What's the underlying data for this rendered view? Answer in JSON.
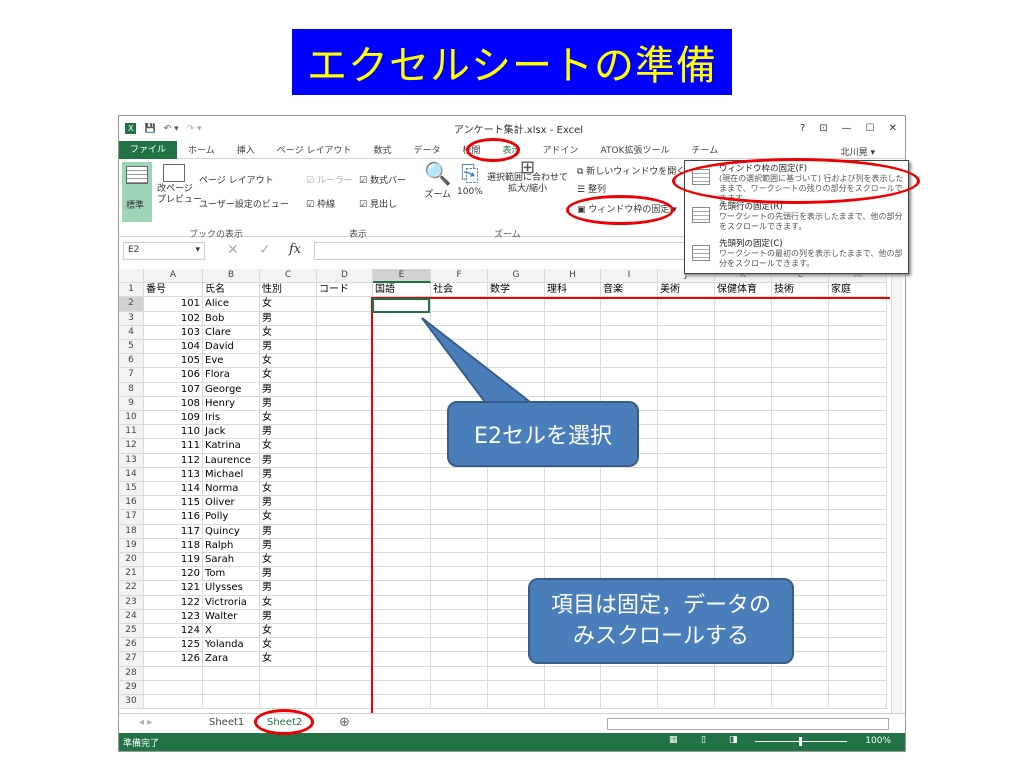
{
  "slide": {
    "title": "エクセルシートの準備",
    "callout1": "E2セルを選択",
    "callout2": "項目は固定，データのみスクロールする"
  },
  "window": {
    "title": "アンケート集計.xlsx - Excel",
    "user": "北川晃 ▾",
    "controls": [
      "?",
      "⊡",
      "—",
      "☐",
      "✕"
    ]
  },
  "tabs": [
    "ファイル",
    "ホーム",
    "挿入",
    "ページ レイアウト",
    "数式",
    "データ",
    "校閲",
    "表示",
    "アドイン",
    "ATOK拡張ツール",
    "チーム"
  ],
  "active_tab": "表示",
  "ribbon": {
    "normal": "標準",
    "page_break": "改ページ\nプレビュー",
    "page_layout": "ページ レイアウト",
    "custom_view": "ユーザー設定のビュー",
    "group_book": "ブックの表示",
    "ruler": "ルーラー",
    "formula_bar": "数式バー",
    "gridlines": "枠線",
    "headings": "見出し",
    "group_show": "表示",
    "zoom": "ズーム",
    "zoom100": "100%",
    "zoom_sel": "選択範囲に合わせて\n拡大/縮小",
    "group_zoom": "ズーム",
    "new_window": "新しいウィンドウを開く",
    "arrange": "整列",
    "freeze": "ウィンドウ枠の固定 ▾"
  },
  "freeze_menu": [
    {
      "label": "ウィンドウ枠の固定(F)",
      "desc": "(現在の選択範囲に基づいて) 行および列を表示したままで、ワークシートの残りの部分をスクロールできます。"
    },
    {
      "label": "先頭行の固定(R)",
      "desc": "ワークシートの先頭行を表示したままで、他の部分をスクロールできます。"
    },
    {
      "label": "先頭列の固定(C)",
      "desc": "ワークシートの最初の列を表示したままで、他の部分をスクロールできます。"
    }
  ],
  "namebox": "E2",
  "fx": "fx",
  "columns": [
    "A",
    "B",
    "C",
    "D",
    "E",
    "F",
    "G",
    "H",
    "I",
    "J",
    "K",
    "L",
    "M"
  ],
  "header_row": [
    "番号",
    "氏名",
    "性別",
    "コード",
    "国語",
    "社会",
    "数学",
    "理科",
    "音楽",
    "美術",
    "保健体育",
    "技術",
    "家庭"
  ],
  "rows": [
    [
      "101",
      "Alice",
      "女"
    ],
    [
      "102",
      "Bob",
      "男"
    ],
    [
      "103",
      "Clare",
      "女"
    ],
    [
      "104",
      "David",
      "男"
    ],
    [
      "105",
      "Eve",
      "女"
    ],
    [
      "106",
      "Flora",
      "女"
    ],
    [
      "107",
      "George",
      "男"
    ],
    [
      "108",
      "Henry",
      "男"
    ],
    [
      "109",
      "Iris",
      "女"
    ],
    [
      "110",
      "Jack",
      "男"
    ],
    [
      "111",
      "Katrina",
      "女"
    ],
    [
      "112",
      "Laurence",
      "男"
    ],
    [
      "113",
      "Michael",
      "男"
    ],
    [
      "114",
      "Norma",
      "女"
    ],
    [
      "115",
      "Oliver",
      "男"
    ],
    [
      "116",
      "Polly",
      "女"
    ],
    [
      "117",
      "Quincy",
      "男"
    ],
    [
      "118",
      "Ralph",
      "男"
    ],
    [
      "119",
      "Sarah",
      "女"
    ],
    [
      "120",
      "Tom",
      "男"
    ],
    [
      "121",
      "Ulysses",
      "男"
    ],
    [
      "122",
      "Victroria",
      "女"
    ],
    [
      "123",
      "Walter",
      "男"
    ],
    [
      "124",
      "X",
      "女"
    ],
    [
      "125",
      "Yolanda",
      "女"
    ],
    [
      "126",
      "Zara",
      "女"
    ]
  ],
  "row_count": 30,
  "sheets": [
    "Sheet1",
    "Sheet2"
  ],
  "active_sheet": "Sheet2",
  "status": {
    "text": "準備完了",
    "zoom": "100%"
  },
  "colors": {
    "excel_green": "#217346",
    "title_bg": "#0000ff",
    "title_fg": "#ffff00",
    "callout": "#4a7ebb",
    "highlight": "#e00000"
  }
}
